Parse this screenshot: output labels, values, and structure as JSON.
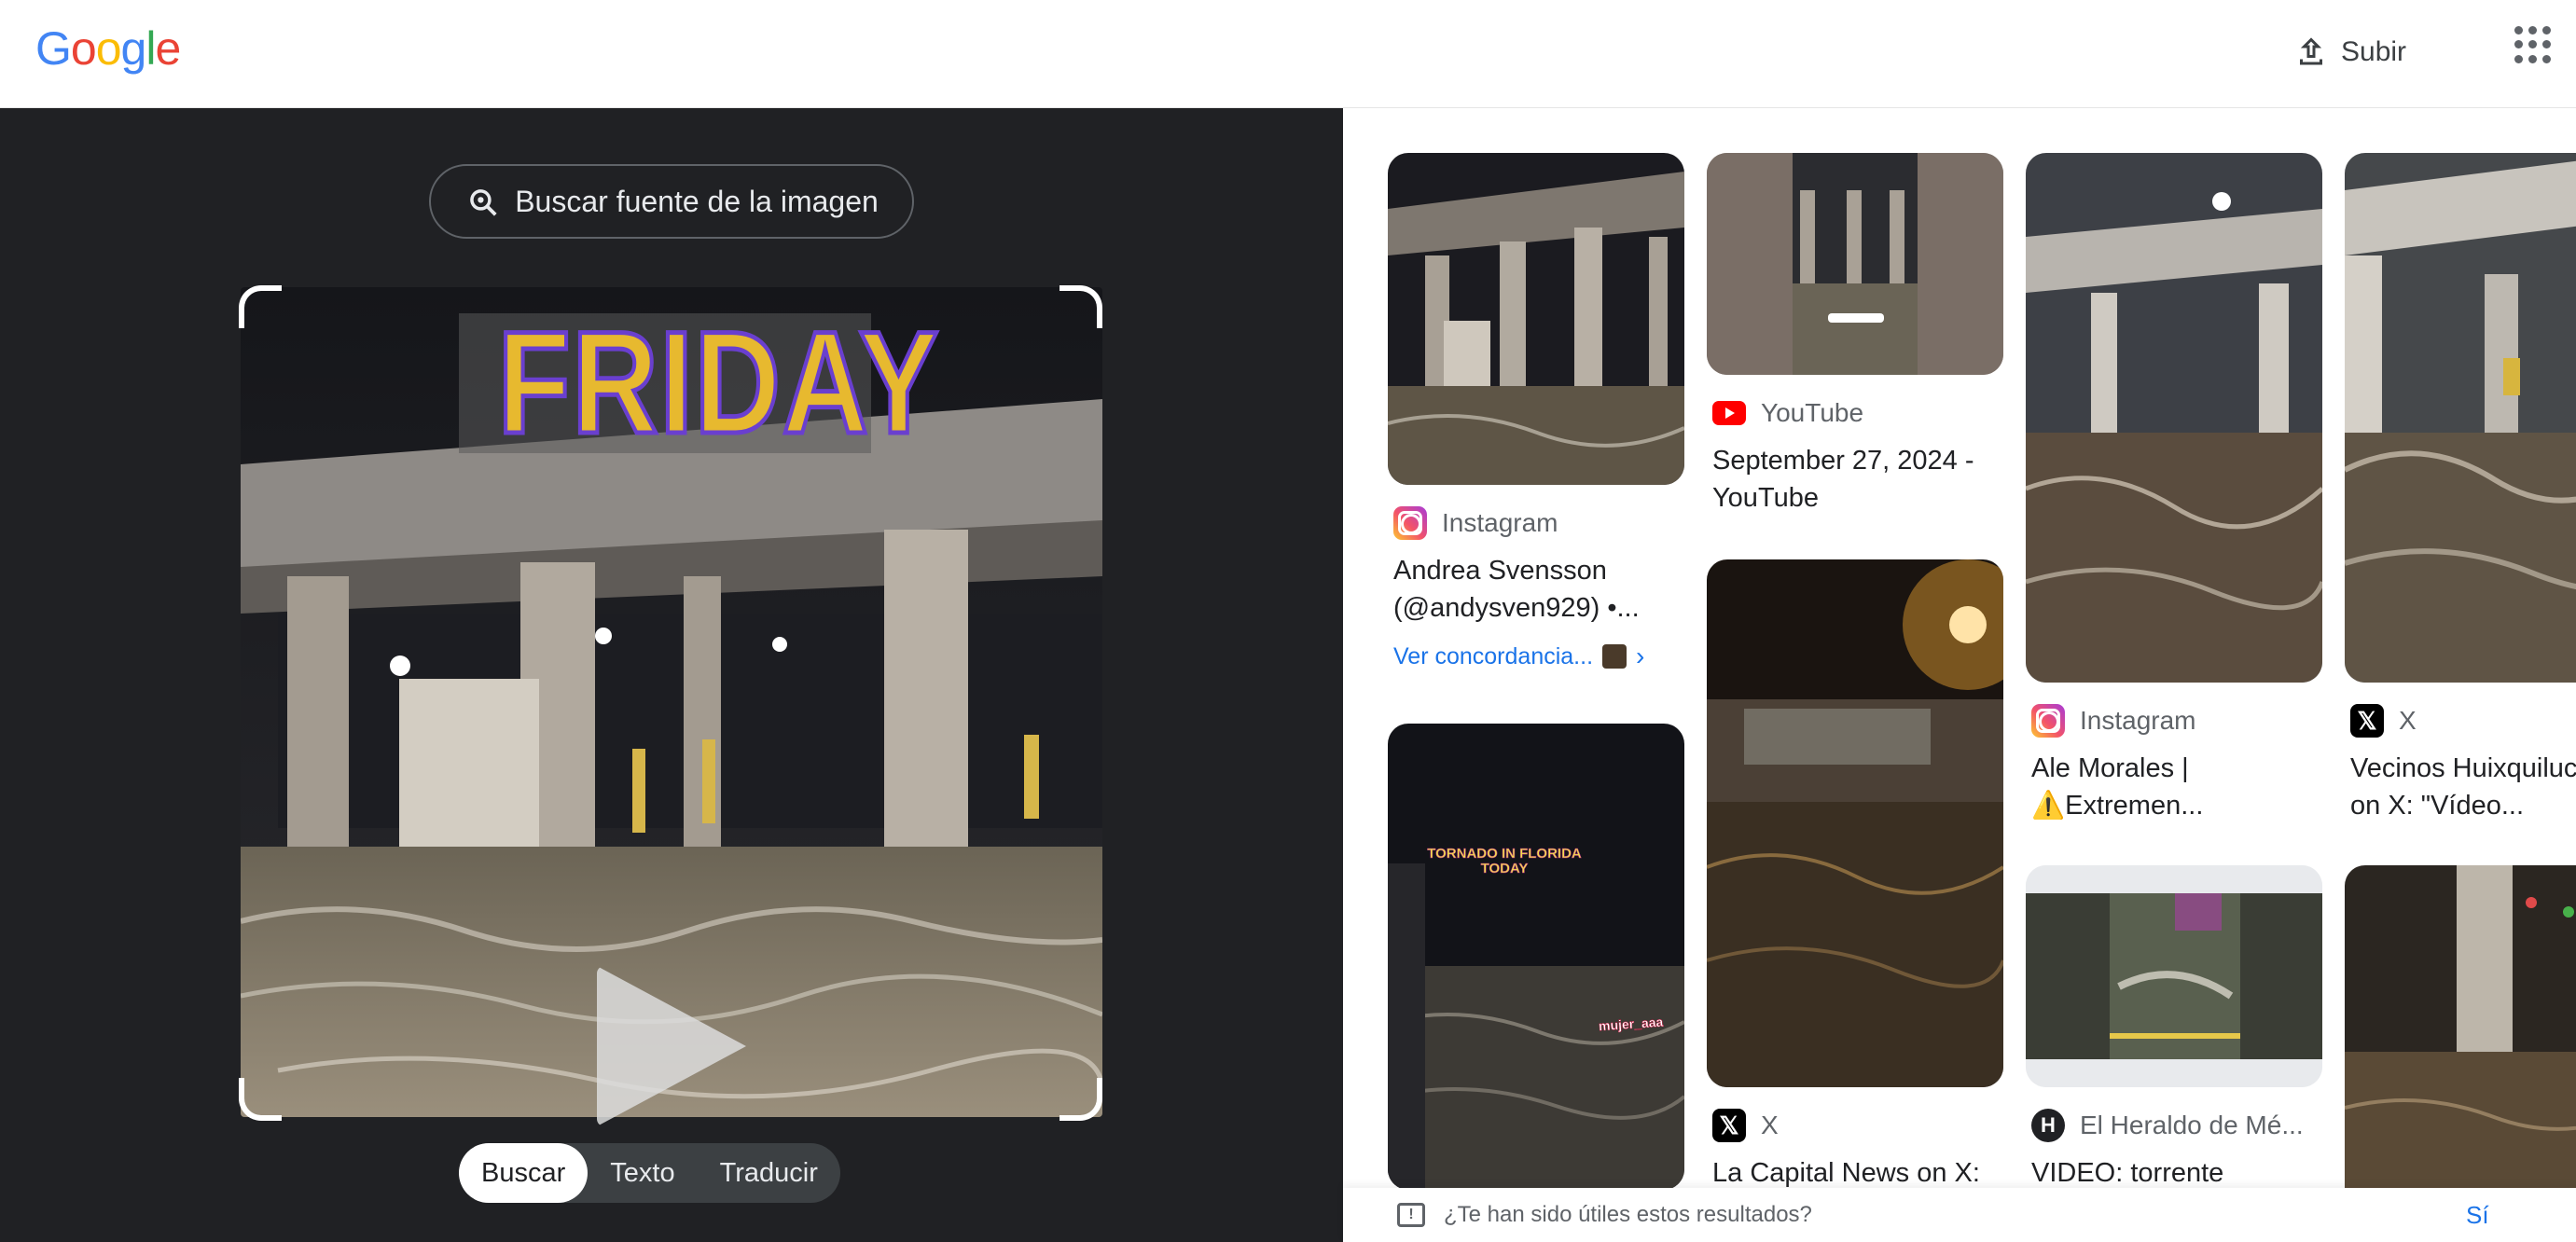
{
  "header": {
    "logo": [
      "G",
      "o",
      "o",
      "g",
      "l",
      "e"
    ],
    "logo_colors": [
      "#4285F4",
      "#EA4335",
      "#FBBC05",
      "#4285F4",
      "#34A853",
      "#EA4335"
    ],
    "upload_label": "Subir"
  },
  "lens": {
    "find_source_label": "Buscar fuente de la imagen",
    "overlay_text": "FRIDAY",
    "modes": [
      "Buscar",
      "Texto",
      "Traducir"
    ],
    "active_mode": "Buscar"
  },
  "results": [
    {
      "source": "Instagram",
      "icon": "instagram-icon",
      "title": "Andrea Svensson (@andysven929) •...",
      "link": "Ver concordancia..."
    },
    {
      "source": "YouTube",
      "icon": "youtube-icon",
      "title": "September 27, 2024 - YouTube"
    },
    {
      "source": "Instagram",
      "icon": "instagram-icon",
      "title": "Ale Morales | ⚠️Extremen..."
    },
    {
      "source": "X",
      "icon": "x-icon",
      "title": "Vecinos Huixquilucan on X: \"Vídeo..."
    },
    {
      "source": "X",
      "icon": "x-icon",
      "title": "La Capital News on X:"
    },
    {
      "source": "El Heraldo de Mé...",
      "icon": "heraldo-icon",
      "title": "VIDEO: torrente"
    },
    {
      "overlay_text": "TORNADO IN FLORIDA TODAY",
      "watermark": "mujer_aaa"
    }
  ],
  "feedback": {
    "question": "¿Te han sido útiles estos resultados?",
    "yes_label": "Sí"
  }
}
